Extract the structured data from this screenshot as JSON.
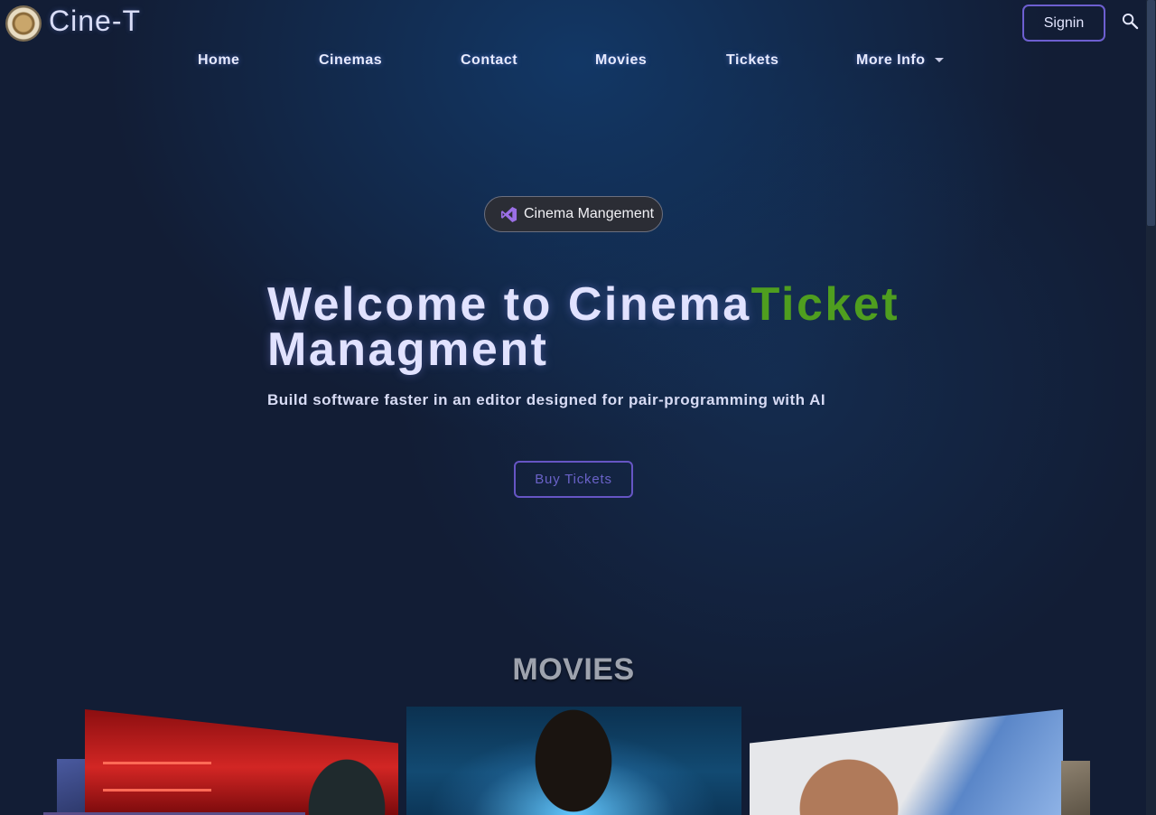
{
  "header": {
    "brand": "Cine-T",
    "signin_label": "Signin",
    "search_icon": "search-icon",
    "logo_icon": "emblem-logo"
  },
  "nav": {
    "items": [
      {
        "label": "Home"
      },
      {
        "label": "Cinemas"
      },
      {
        "label": "Contact"
      },
      {
        "label": "Movies"
      },
      {
        "label": "Tickets"
      },
      {
        "label": "More Info",
        "has_dropdown": true
      }
    ]
  },
  "badge": {
    "label": "Cinema Mangement",
    "icon": "visual-studio-icon"
  },
  "hero": {
    "title_part1": "Welcome to Cinema",
    "title_accent": "Ticket",
    "title_part2": "Managment",
    "subtitle": "Build software faster in an editor designed for pair-programming with AI",
    "cta_label": "Buy Tickets"
  },
  "movies": {
    "heading": "MOVIES"
  },
  "colors": {
    "background": "#121d35",
    "accent_green": "#4f9e1f",
    "button_border": "#6d5fd0",
    "nav_text": "#e7eaff"
  }
}
